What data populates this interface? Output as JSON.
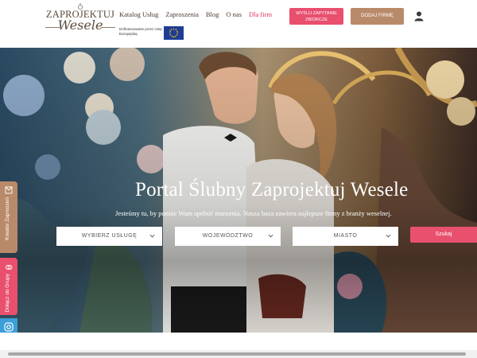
{
  "logo": {
    "line1": "ZAPROJEKTUJ",
    "line2": "Wesele"
  },
  "nav": {
    "items": [
      {
        "label": "Katalog Usług"
      },
      {
        "label": "Zaproszenia"
      },
      {
        "label": "Blog"
      },
      {
        "label": "O nas"
      },
      {
        "label": "Dla firm"
      }
    ]
  },
  "header_buttons": {
    "zbiorcze": "WYŚLIJ ZAPYTANIE ZBIORCZE",
    "dodaj": "DODAJ FIRMĘ"
  },
  "eu": {
    "text": "Dofinansowane przez Unię Europejską"
  },
  "side_tabs": {
    "kreator": "Kreator Zaproszeń",
    "dodaj": "Dołącz do Grupy"
  },
  "hero": {
    "title": "Portal Ślubny Zaprojektuj Wesele",
    "subtitle": "Jesteśmy tu, by pomóc Wam spełnić marzenia. Nasza baza zawiera najlepsze firmy z branży weselnej."
  },
  "search": {
    "service": "WYBIERZ USŁUGĘ",
    "region": "WOJEWÓDZTWO",
    "city": "MIASTO",
    "button": "Szukaj"
  },
  "colors": {
    "accent": "#e8506e",
    "brown": "#b98a6a",
    "instagram": "#3b9fd8",
    "facebook": "#3b5ba8"
  }
}
